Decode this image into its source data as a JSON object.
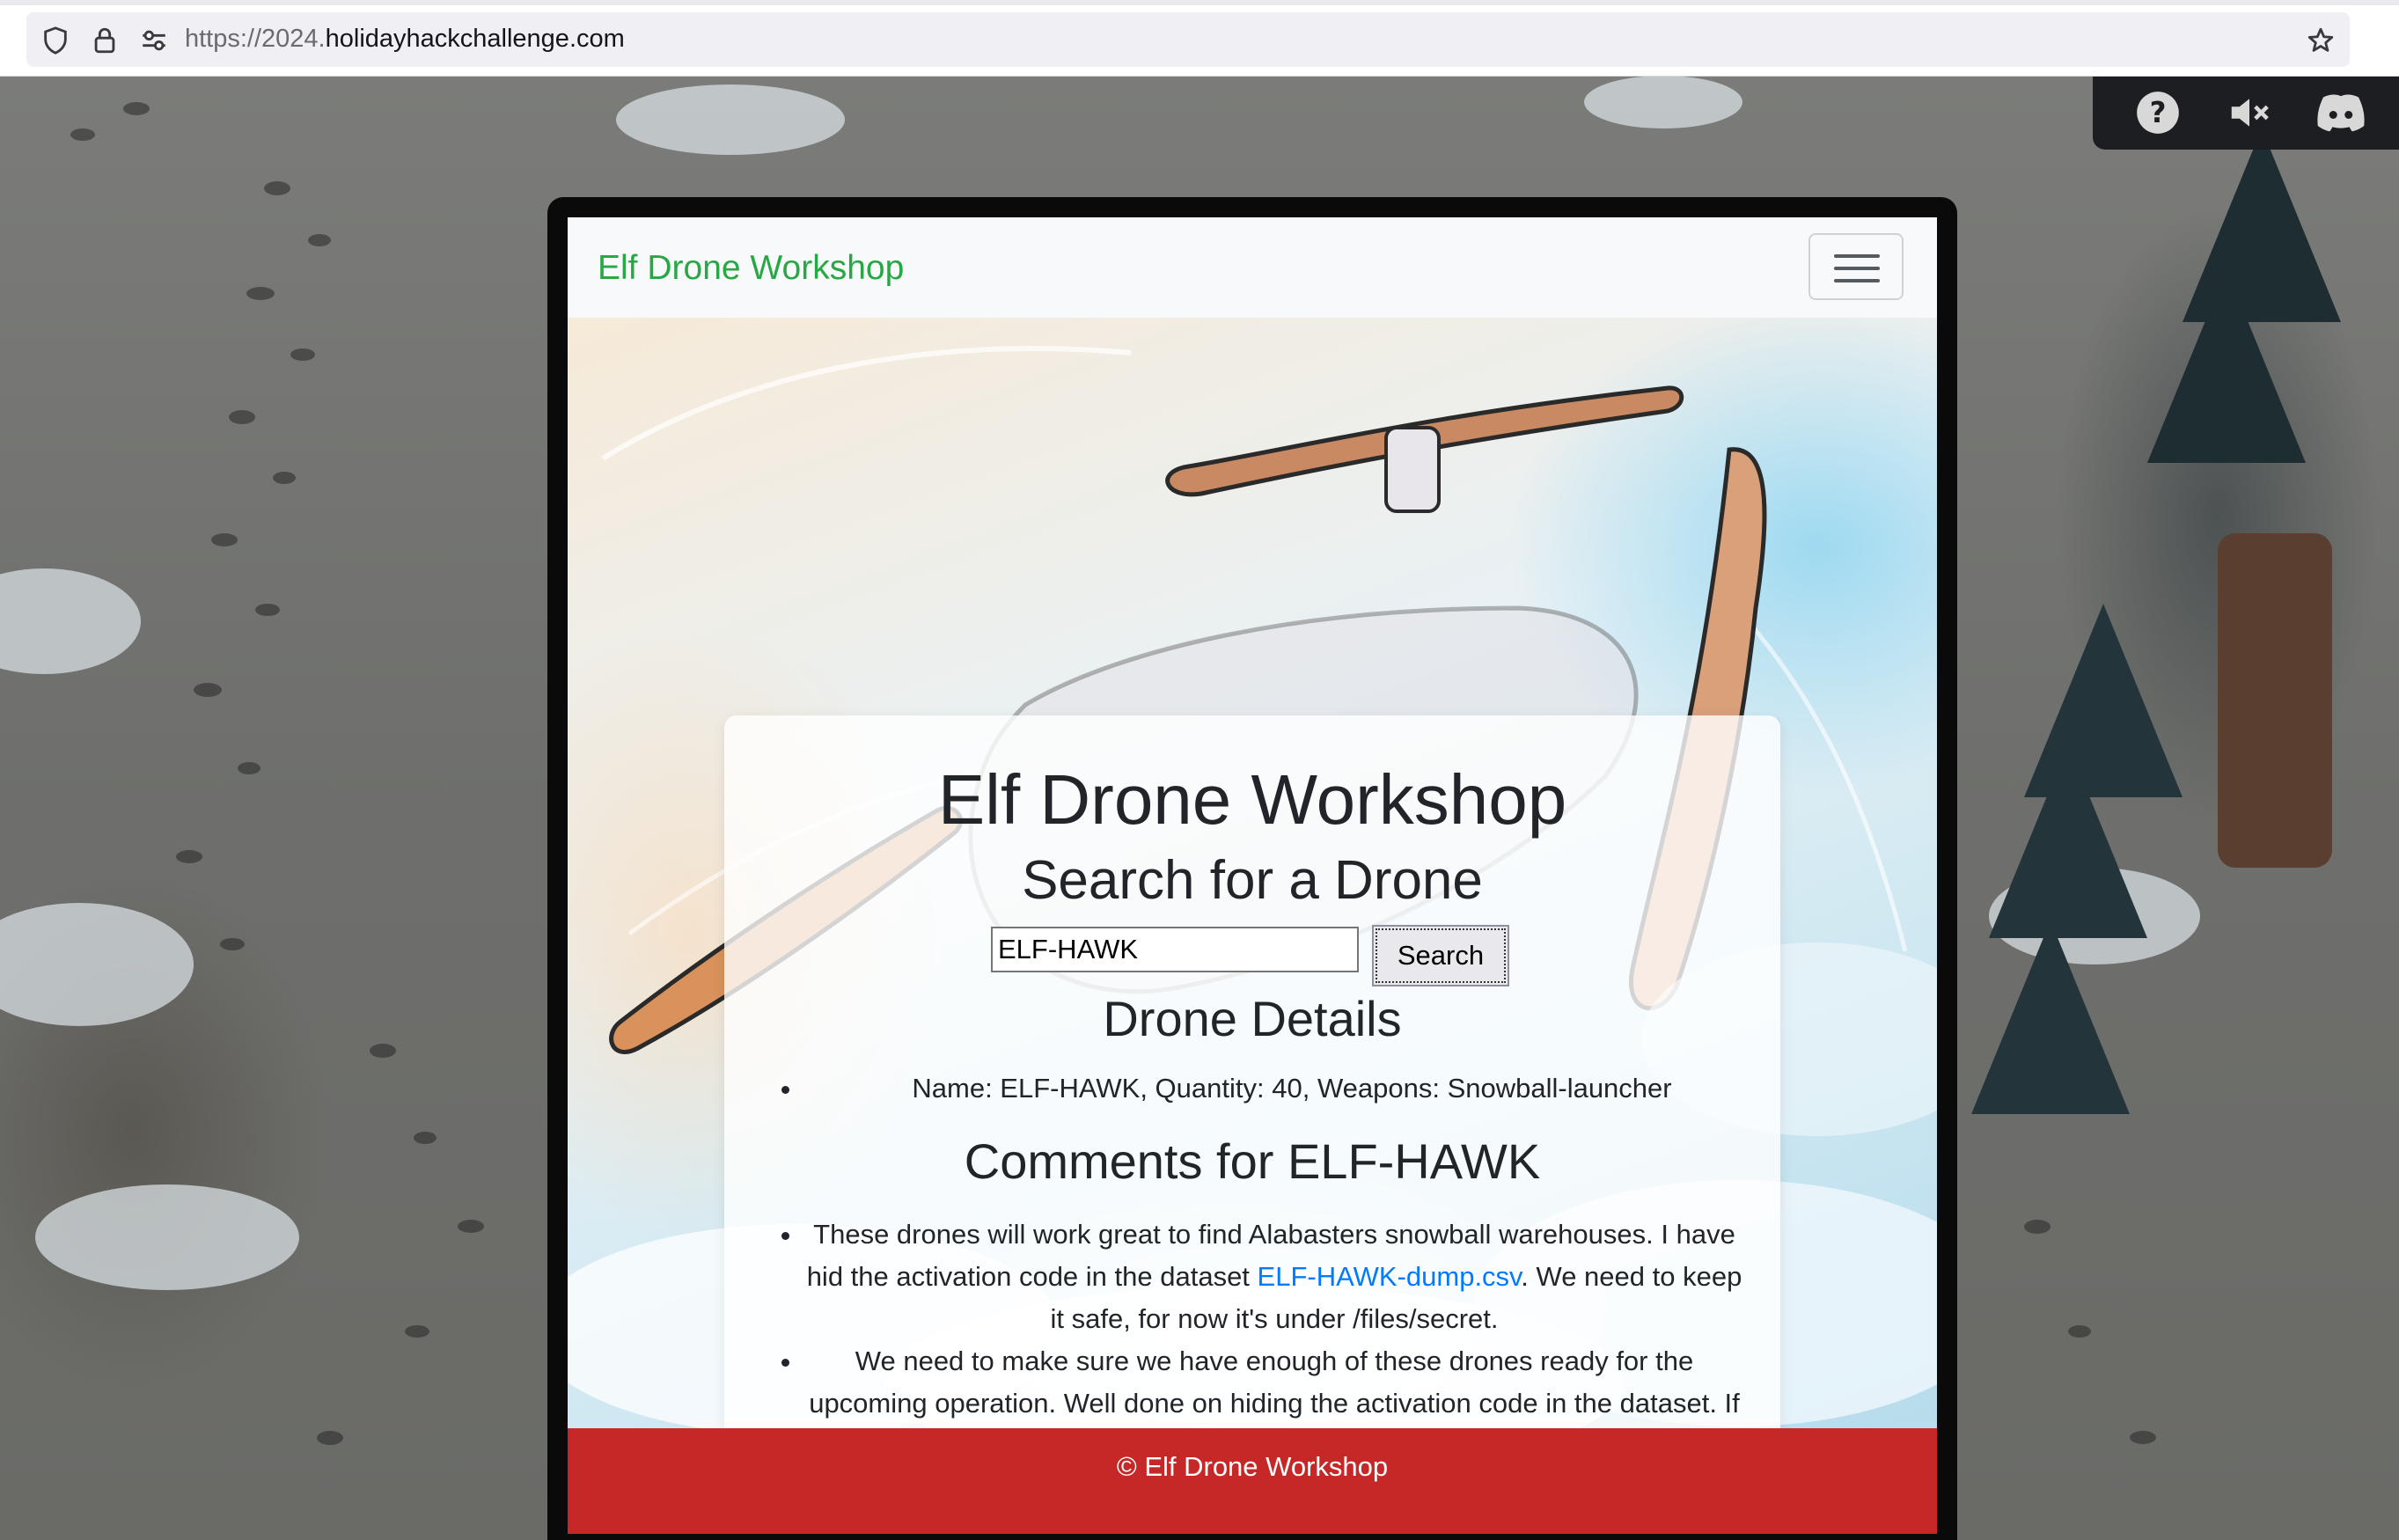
{
  "browser": {
    "url_prefix": "https://2024.",
    "url_domain": "holidayhackchallenge.com"
  },
  "toolbar_icons": [
    "help-icon",
    "mute-icon",
    "discord-icon"
  ],
  "navbar": {
    "brand": "Elf Drone Workshop"
  },
  "main": {
    "title": "Elf Drone Workshop",
    "subtitle": "Search for a Drone",
    "search": {
      "value": "ELF-HAWK",
      "button_label": "Search"
    },
    "details_heading": "Drone Details",
    "details": [
      "Name: ELF-HAWK, Quantity: 40, Weapons: Snowball-launcher"
    ],
    "comments_heading": "Comments for ELF-HAWK",
    "comments": [
      {
        "before": "These drones will work great to find Alabasters snowball warehouses. I have hid the activation code in the dataset ",
        "link": "ELF-HAWK-dump.csv",
        "after": ". We need to keep it safe, for now it's under /files/secret."
      },
      {
        "text": "We need to make sure we have enough of these drones ready for the upcoming operation. Well done on hiding the activation code in the dataset. If anyone finds it, it will take them a LONG time or forever to carve the data out, preferably the LATTER."
      }
    ]
  },
  "footer": {
    "text": "© Elf Drone Workshop"
  },
  "colors": {
    "brand": "#28a745",
    "footer_bg": "#c62828",
    "link": "#007bff"
  }
}
